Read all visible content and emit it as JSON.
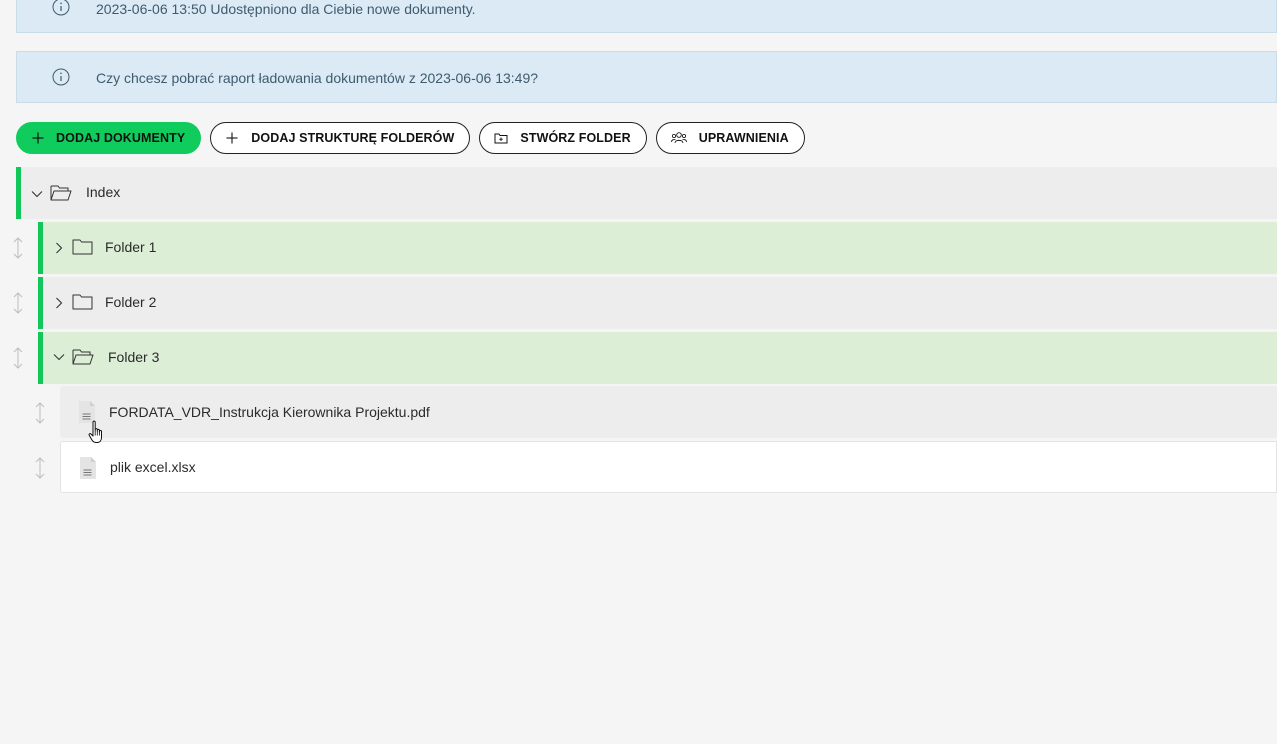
{
  "notices": [
    {
      "text": "2023-06-06 13:50 Udostępniono dla Ciebie nowe dokumenty.",
      "icon": "info-icon"
    },
    {
      "text": "Czy chcesz pobrać raport ładowania dokumentów z 2023-06-06 13:49?",
      "icon": "info-icon"
    }
  ],
  "toolbar": {
    "add_documents": "DODAJ DOKUMENTY",
    "add_folder_structure": "DODAJ STRUKTURĘ FOLDERÓW",
    "create_folder": "STWÓRZ FOLDER",
    "permissions": "UPRAWNIENIA"
  },
  "tree": {
    "root": {
      "label": "Index",
      "expanded": true
    },
    "folders": [
      {
        "label": "Folder 1",
        "expanded": false
      },
      {
        "label": "Folder 2",
        "expanded": false
      },
      {
        "label": "Folder 3",
        "expanded": true
      }
    ],
    "files": [
      {
        "label": "FORDATA_VDR_Instrukcja Kierownika Projektu.pdf"
      },
      {
        "label": "plik excel.xlsx"
      }
    ]
  },
  "colors": {
    "accent": "#11c759",
    "primary_button": "#0fcc5d",
    "notice_bg": "#dbeaf5",
    "row_highlight": "#ddeed7",
    "row_grey": "#ededed"
  }
}
